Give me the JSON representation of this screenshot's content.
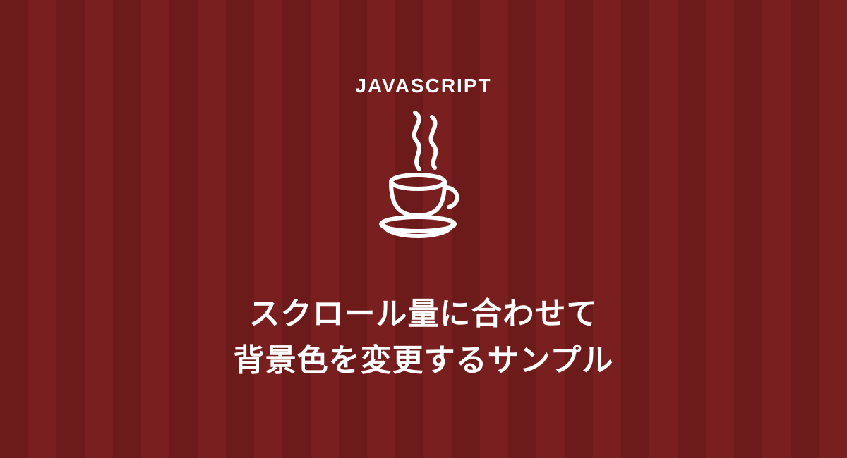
{
  "hero": {
    "category": "JAVASCRIPT",
    "icon_name": "java-coffee-cup",
    "title_line1": "スクロール量に合わせて",
    "title_line2": "背景色を変更するサンプル"
  },
  "colors": {
    "stripe_dark": "#6d1a1a",
    "stripe_light": "#7a1f1f",
    "text": "#ffffff"
  }
}
